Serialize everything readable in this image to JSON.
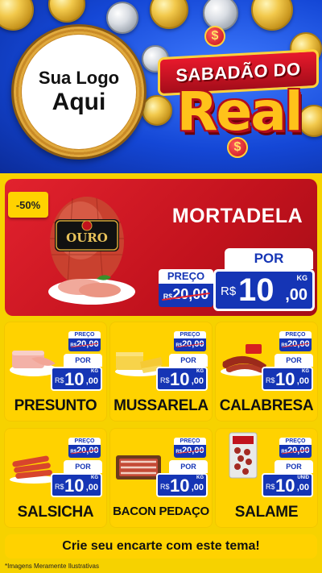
{
  "header": {
    "logo_line1": "Sua Logo",
    "logo_line2": "Aqui",
    "title_top": "SABADÃO DO",
    "title_big": "Real",
    "currency_symbol": "$"
  },
  "hero": {
    "discount": "-50%",
    "name": "MORTADELA",
    "preco_label": "PREÇO",
    "old_prefix": "R$",
    "old_price": "20,00",
    "por_label": "POR",
    "new_prefix": "R$",
    "new_int": "10",
    "new_dec": ",00",
    "unit": "KG",
    "brand_label": "OURO"
  },
  "products": [
    {
      "name": "PRESUNTO",
      "preco_label": "PREÇO",
      "old_prefix": "R$",
      "old_price": "20,00",
      "por_label": "POR",
      "new_prefix": "R$",
      "new_int": "10",
      "new_dec": ",00",
      "unit": "KG"
    },
    {
      "name": "MUSSARELA",
      "preco_label": "PREÇO",
      "old_prefix": "R$",
      "old_price": "20,00",
      "por_label": "POR",
      "new_prefix": "R$",
      "new_int": "10",
      "new_dec": ",00",
      "unit": "KG"
    },
    {
      "name": "CALABRESA",
      "preco_label": "PREÇO",
      "old_prefix": "R$",
      "old_price": "20,00",
      "por_label": "POR",
      "new_prefix": "R$",
      "new_int": "10",
      "new_dec": ",00",
      "unit": "KG"
    },
    {
      "name": "SALSICHA",
      "preco_label": "PREÇO",
      "old_prefix": "R$",
      "old_price": "20,00",
      "por_label": "POR",
      "new_prefix": "R$",
      "new_int": "10",
      "new_dec": ",00",
      "unit": "KG"
    },
    {
      "name": "BACON PEDAÇO",
      "preco_label": "PREÇO",
      "old_prefix": "R$",
      "old_price": "20,00",
      "por_label": "POR",
      "new_prefix": "R$",
      "new_int": "10",
      "new_dec": ",00",
      "unit": "KG"
    },
    {
      "name": "SALAME",
      "preco_label": "PREÇO",
      "old_prefix": "R$",
      "old_price": "20,00",
      "por_label": "POR",
      "new_prefix": "R$",
      "new_int": "10",
      "new_dec": ",00",
      "unit": "UNID"
    }
  ],
  "footer": {
    "cta": "Crie seu encarte com este tema!",
    "disclaimer": "*Imagens Meramente Ilustrativas"
  },
  "colors": {
    "background_yellow": "#f6d200",
    "header_blue": "#1447d6",
    "hero_red": "#e2222e",
    "price_blue": "#1535b5",
    "title_gold": "#ffc21a"
  }
}
